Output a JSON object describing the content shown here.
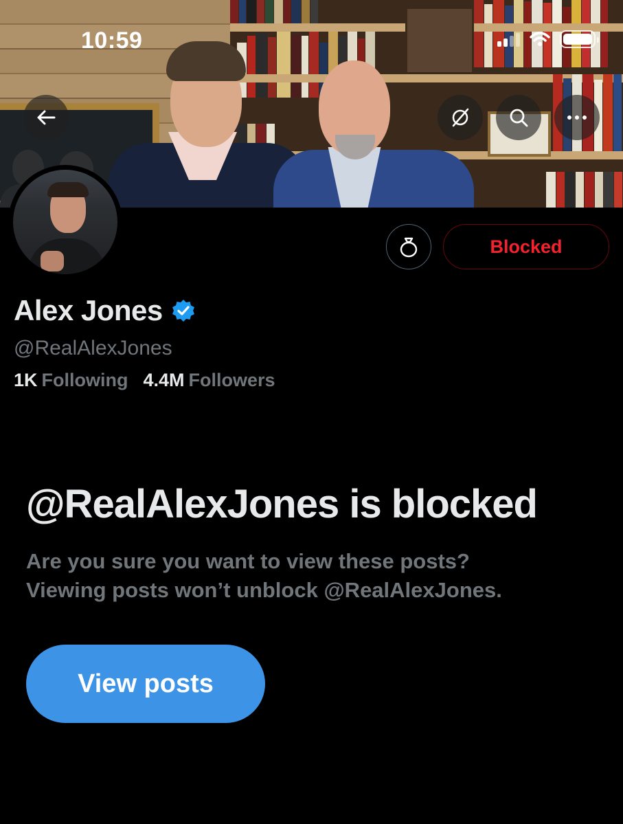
{
  "status_bar": {
    "time": "10:59"
  },
  "header": {
    "buttons": {
      "back": "arrow-left-icon",
      "grok": "grok-slash-icon",
      "search": "search-icon",
      "more": "more-icon"
    }
  },
  "profile": {
    "name": "Alex Jones",
    "handle": "@RealAlexJones",
    "verified": true,
    "following_count": "1K",
    "following_label": "Following",
    "followers_count": "4.4M",
    "followers_label": "Followers"
  },
  "actions": {
    "blocked_label": "Blocked",
    "tip_icon": "money-bag-icon"
  },
  "blocked_notice": {
    "title": "@RealAlexJones is blocked",
    "line1": "Are you sure you want to view these posts?",
    "line2": "Viewing posts won’t unblock @RealAlexJones.",
    "button_label": "View posts"
  },
  "colors": {
    "background": "#000000",
    "primary_text": "#e7e9ea",
    "secondary_text": "#71767b",
    "blocked_red": "#f4212e",
    "accent_blue": "#3d93e6",
    "verified_blue": "#1d9bf0"
  }
}
